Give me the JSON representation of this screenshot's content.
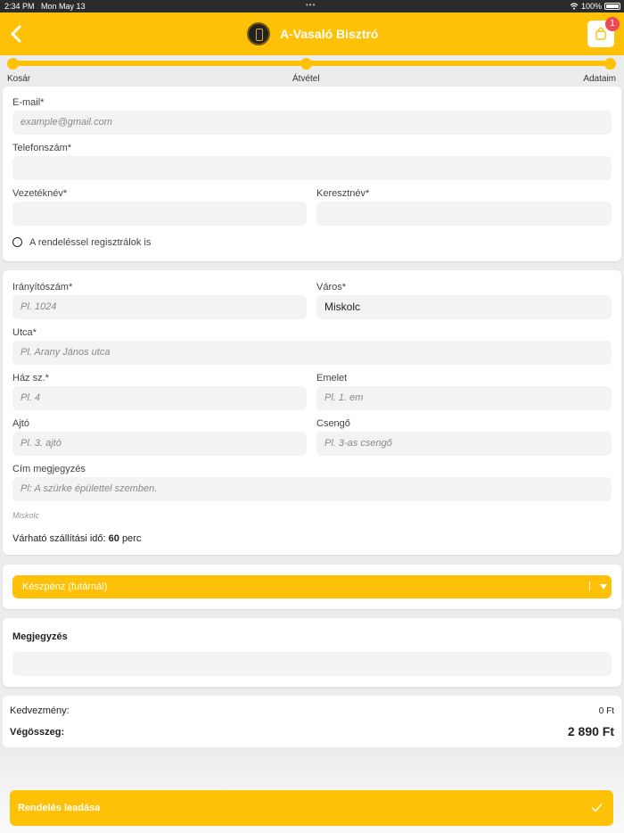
{
  "status_bar": {
    "time": "2:34 PM",
    "date": "Mon May 13",
    "battery": "100%"
  },
  "nav": {
    "title": "A-Vasaló Bisztró",
    "cart_count": "1"
  },
  "progress": {
    "steps": [
      "Kosár",
      "Átvétel",
      "Adataim"
    ]
  },
  "contact": {
    "email_label": "E-mail*",
    "email_placeholder": "example@gmail.com",
    "phone_label": "Telefonszám*",
    "lastname_label": "Vezetéknév*",
    "firstname_label": "Keresztnév*",
    "register_label": "A rendeléssel regisztrálok is"
  },
  "address": {
    "zip_label": "Irányítószám*",
    "zip_placeholder": "Pl. 1024",
    "city_label": "Város*",
    "city_value": "Miskolc",
    "street_label": "Utca*",
    "street_placeholder": "Pl. Arany János utca",
    "house_label": "Ház sz.*",
    "house_placeholder": "Pl. 4",
    "floor_label": "Emelet",
    "floor_placeholder": "Pl. 1. em",
    "door_label": "Ajtó",
    "door_placeholder": "Pl. 3. ajtó",
    "bell_label": "Csengő",
    "bell_placeholder": "Pl. 3-as csengő",
    "note_label": "Cím megjegyzés",
    "note_placeholder": "Pl: A szürke épülettel szemben.",
    "city_hint": "Miskolc",
    "delivery_prefix": "Várható szállítási idő:",
    "delivery_minutes": "60",
    "delivery_unit": "perc"
  },
  "payment": {
    "selected": "Készpénz (futárnál)",
    "separator": "|"
  },
  "note": {
    "label": "Megjegyzés"
  },
  "summary": {
    "discount_label": "Kedvezmény:",
    "discount_value": "0 Ft",
    "total_label": "Végösszeg:",
    "total_value": "2 890 Ft"
  },
  "submit": {
    "label": "Rendelés leadása"
  },
  "colors": {
    "accent": "#ffc107",
    "badge": "#f04a5a",
    "input_bg": "#f1f3f4"
  }
}
